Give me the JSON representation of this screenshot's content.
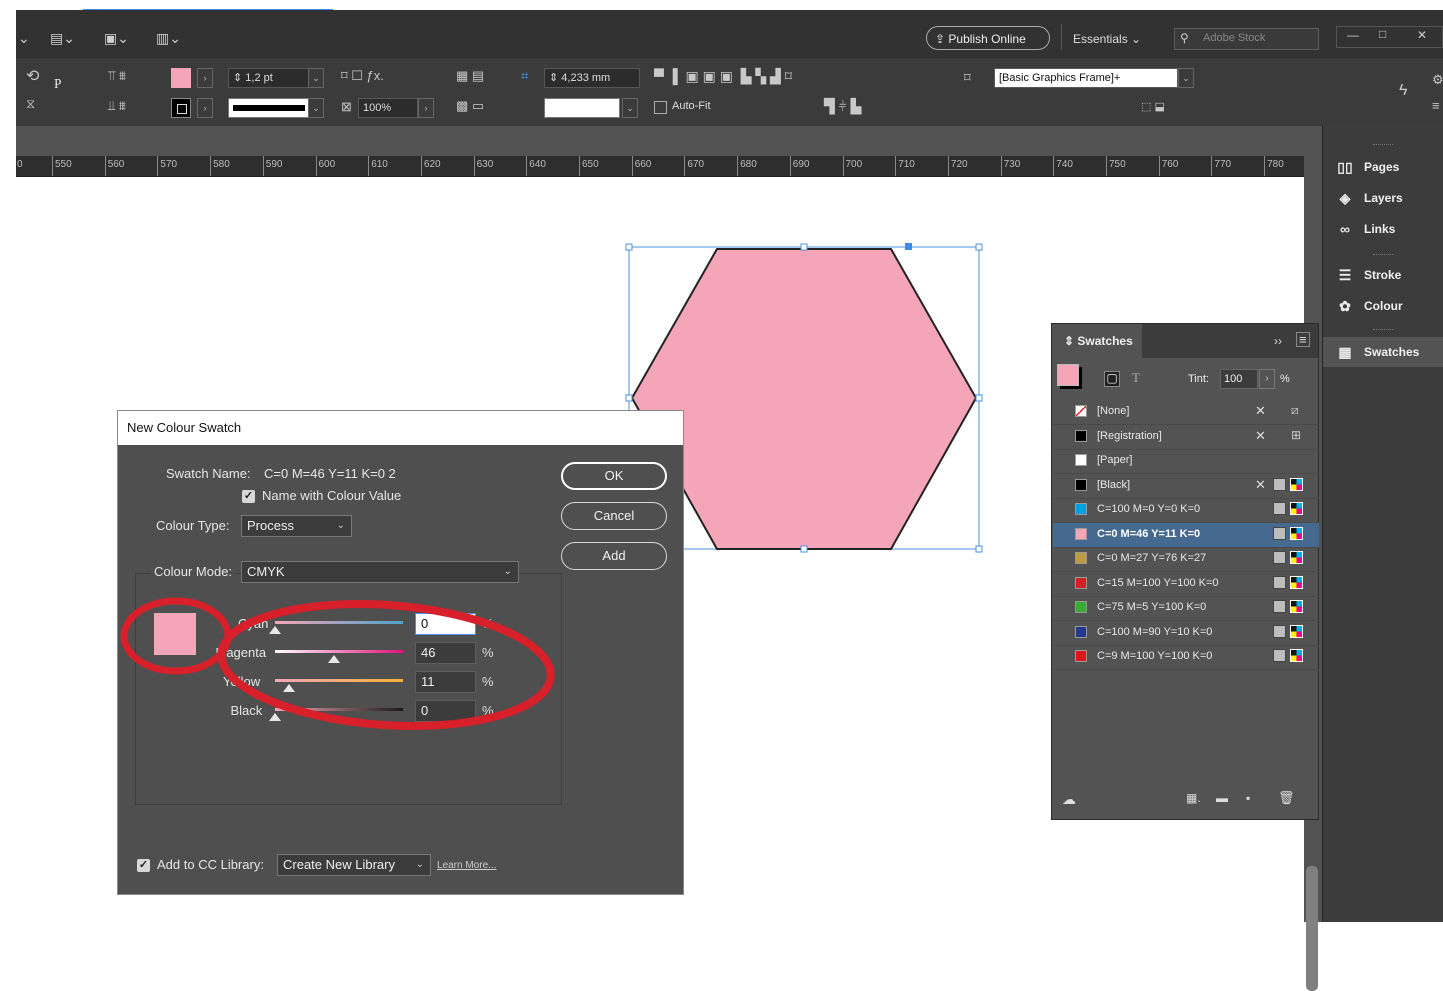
{
  "app_bar": {
    "publish_label": "Publish Online",
    "workspace_label": "Essentials",
    "stock_placeholder": "Adobe Stock",
    "window_min": "—",
    "window_max": "□",
    "window_close": "✕"
  },
  "control_bar": {
    "stroke_weight": "1,2 pt",
    "scale": "100%",
    "spacing": "4,233 mm",
    "auto_fit_label": "Auto-Fit",
    "object_style": "[Basic Graphics Frame]+",
    "fill_color": "#f4a6b8",
    "stroke_color": "#000000"
  },
  "ruler": {
    "ticks": [
      "0",
      "550",
      "560",
      "570",
      "580",
      "590",
      "600",
      "610",
      "620",
      "630",
      "640",
      "650",
      "660",
      "670",
      "680",
      "690",
      "700",
      "710",
      "720",
      "730",
      "740",
      "750",
      "760",
      "770",
      "780"
    ]
  },
  "canvas": {
    "shape_fill": "#f4a6b8",
    "shape_stroke": "#222222"
  },
  "dock": {
    "items": [
      {
        "label": "Pages",
        "icon": "pages-icon"
      },
      {
        "label": "Layers",
        "icon": "layers-icon"
      },
      {
        "label": "Links",
        "icon": "links-icon"
      },
      {
        "label": "Stroke",
        "icon": "stroke-icon"
      },
      {
        "label": "Colour",
        "icon": "colour-icon"
      },
      {
        "label": "Swatches",
        "icon": "swatches-icon"
      }
    ]
  },
  "swatches_panel": {
    "title": "Swatches",
    "tint_label": "Tint:",
    "tint_value": "100",
    "tint_unit": "%",
    "rows": [
      {
        "name": "[None]",
        "color": "#ffffff",
        "selected": false
      },
      {
        "name": "[Registration]",
        "color": "#000000",
        "selected": false
      },
      {
        "name": "[Paper]",
        "color": "#ffffff",
        "selected": false
      },
      {
        "name": "[Black]",
        "color": "#000000",
        "selected": false
      },
      {
        "name": "C=100 M=0 Y=0 K=0",
        "color": "#009fe3",
        "selected": false
      },
      {
        "name": "C=0 M=46 Y=11 K=0",
        "color": "#f4a6b8",
        "selected": true
      },
      {
        "name": "C=0 M=27 Y=76 K=27",
        "color": "#c09a3c",
        "selected": false
      },
      {
        "name": "C=15 M=100 Y=100 K=0",
        "color": "#d81e25",
        "selected": false
      },
      {
        "name": "C=75 M=5 Y=100 K=0",
        "color": "#3ba935",
        "selected": false
      },
      {
        "name": "C=100 M=90 Y=10 K=0",
        "color": "#263a8c",
        "selected": false
      },
      {
        "name": "C=9 M=100 Y=100 K=0",
        "color": "#e1141b",
        "selected": false
      }
    ]
  },
  "dialog": {
    "title": "New Colour Swatch",
    "swatch_name_label": "Swatch Name:",
    "swatch_name_value": "C=0 M=46 Y=11 K=0 2",
    "name_with_value_label": "Name with Colour Value",
    "colour_type_label": "Colour Type:",
    "colour_type_value": "Process",
    "colour_mode_label": "Colour Mode:",
    "colour_mode_value": "CMYK",
    "preview_color": "#f4a6b8",
    "sliders": [
      {
        "label": "Cyan",
        "value": "0",
        "fraction": 0.0
      },
      {
        "label": "Magenta",
        "value": "46",
        "fraction": 0.46
      },
      {
        "label": "Yellow",
        "value": "11",
        "fraction": 0.11
      },
      {
        "label": "Black",
        "value": "0",
        "fraction": 0.0
      }
    ],
    "percent": "%",
    "ok_label": "OK",
    "cancel_label": "Cancel",
    "add_label": "Add",
    "cc_label": "Add to CC Library:",
    "cc_value": "Create New Library",
    "learn_more": "Learn More..."
  },
  "annotation_color": "#d8202a"
}
